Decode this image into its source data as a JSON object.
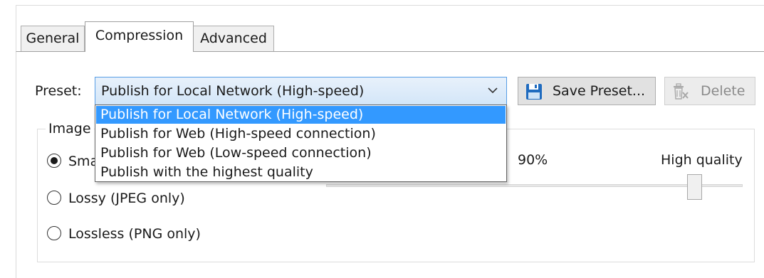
{
  "tabs": [
    {
      "label": "General",
      "active": false
    },
    {
      "label": "Compression",
      "active": true
    },
    {
      "label": "Advanced",
      "active": false
    }
  ],
  "preset": {
    "label": "Preset:",
    "selected": "Publish for Local Network (High-speed)",
    "options": [
      "Publish for Local Network (High-speed)",
      "Publish for Web (High-speed connection)",
      "Publish for Web (Low-speed connection)",
      "Publish with the highest quality"
    ],
    "dropdown_open": true
  },
  "buttons": {
    "save_preset": "Save Preset...",
    "delete": "Delete",
    "delete_enabled": false
  },
  "image_group": {
    "title": "Image",
    "options": [
      {
        "label": "Sma",
        "checked": true
      },
      {
        "label": "Lossy (JPEG only)",
        "checked": false
      },
      {
        "label": "Lossless (PNG only)",
        "checked": false
      }
    ],
    "quality_value": "90%",
    "quality_high_label": "High quality",
    "quality_level": 0.9
  },
  "colors": {
    "selection": "#3399ff",
    "combo_border": "#569de5",
    "save_icon": "#1f6bbf"
  },
  "icons": {
    "save": "floppy-disk-icon",
    "delete": "delete-icon",
    "dropdown": "chevron-down-icon"
  }
}
